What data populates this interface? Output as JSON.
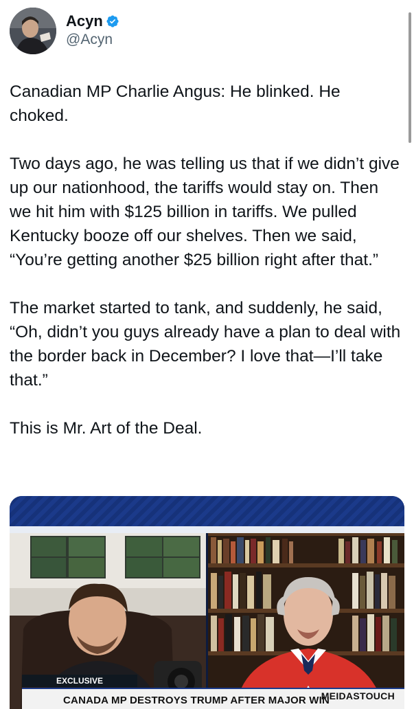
{
  "author": {
    "display_name": "Acyn",
    "handle": "@Acyn",
    "verified_icon": "verified-badge-icon"
  },
  "tweet": {
    "paragraphs": [
      "Canadian MP Charlie Angus: He blinked. He choked.",
      "Two days ago, he was telling us that if we didn’t give up our nationhood, the tariffs would stay on. Then we hit him with $125 billion in tariffs. We pulled Kentucky booze off our shelves. Then we said, “You’re getting another $25 billion right after that.”",
      "The market started to tank, and suddenly, he said, “Oh, didn’t you guys already have a plan to deal with the border back in December? I love that—I’ll take that.”",
      "This is Mr. Art of the Deal."
    ]
  },
  "media": {
    "badge": "EXCLUSIVE",
    "headline": "CANADA MP DESTROYS TRUMP AFTER MAJOR WIN",
    "brand": "MEIDASTOUCH"
  },
  "colors": {
    "verified_blue": "#1d9bf0",
    "text": "#0f1419",
    "secondary_text": "#536471",
    "banner_blue": "#1b3a8a"
  }
}
